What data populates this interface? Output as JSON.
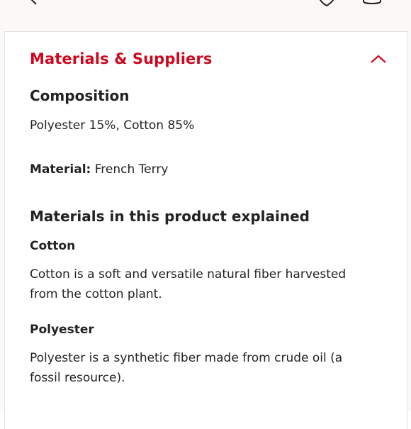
{
  "icons": {
    "back": "chevron-left-icon",
    "favorite": "heart-icon",
    "bag": "shopping-bag-icon",
    "collapse": "chevron-up-icon"
  },
  "colors": {
    "accent": "#cc071e",
    "text": "#222222",
    "background": "#faf9f8"
  },
  "section": {
    "title": "Materials & Suppliers"
  },
  "composition": {
    "heading": "Composition",
    "value": "Polyester 15%, Cotton 85%"
  },
  "material": {
    "label": "Material:",
    "value": "French Terry"
  },
  "explained": {
    "heading": "Materials in this product explained",
    "items": [
      {
        "name": "Cotton",
        "description": "Cotton is a soft and versatile natural fiber harvested from the cotton plant."
      },
      {
        "name": "Polyester",
        "description": "Polyester is a synthetic fiber made from crude oil (a fossil resource)."
      }
    ]
  }
}
